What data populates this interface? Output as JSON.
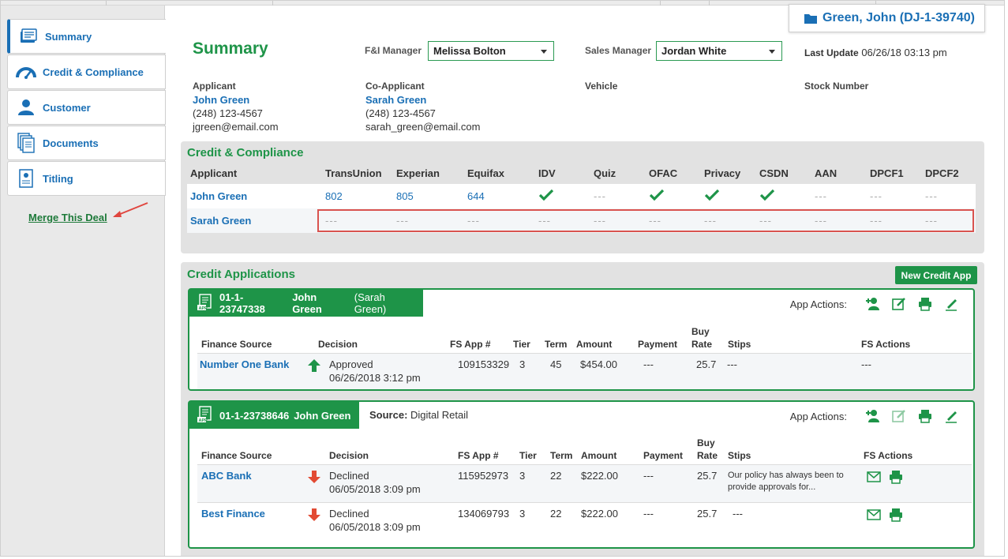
{
  "deal": {
    "label": "Green, John (DJ-1-39740)"
  },
  "sidebar": {
    "items": [
      {
        "label": "Summary"
      },
      {
        "label": "Credit & Compliance"
      },
      {
        "label": "Customer"
      },
      {
        "label": "Documents"
      },
      {
        "label": "Titling"
      }
    ],
    "merge_link": "Merge This Deal"
  },
  "header": {
    "title": "Summary",
    "fi_manager_label": "F&I Manager",
    "fi_manager_value": "Melissa Bolton",
    "sales_manager_label": "Sales Manager",
    "sales_manager_value": "Jordan White",
    "last_update_label": "Last Update",
    "last_update_value": "06/26/18 03:13 pm"
  },
  "parties": {
    "applicant": {
      "label": "Applicant",
      "name": "John Green",
      "phone": "(248) 123-4567",
      "email": "jgreen@email.com"
    },
    "co_applicant": {
      "label": "Co-Applicant",
      "name": "Sarah Green",
      "phone": "(248) 123-4567",
      "email": "sarah_green@email.com"
    },
    "vehicle_label": "Vehicle",
    "stock_label": "Stock Number"
  },
  "compliance": {
    "title": "Credit & Compliance",
    "headers": [
      "Applicant",
      "TransUnion",
      "Experian",
      "Equifax",
      "IDV",
      "Quiz",
      "OFAC",
      "Privacy",
      "CSDN",
      "AAN",
      "DPCF1",
      "DPCF2"
    ],
    "rows": [
      {
        "name": "John Green",
        "transunion": "802",
        "experian": "805",
        "equifax": "644",
        "idv": "check",
        "quiz": "---",
        "ofac": "check",
        "privacy": "check",
        "csdn": "check",
        "aan": "---",
        "dpcf1": "---",
        "dpcf2": "---"
      },
      {
        "name": "Sarah Green",
        "transunion": "---",
        "experian": "---",
        "equifax": "---",
        "idv": "---",
        "quiz": "---",
        "ofac": "---",
        "privacy": "---",
        "csdn": "---",
        "aan": "---",
        "dpcf1": "---",
        "dpcf2": "---"
      }
    ],
    "dash": "---"
  },
  "credit_apps": {
    "title": "Credit Applications",
    "new_button": "New Credit App",
    "actions_label": "App Actions:",
    "columns": {
      "finance_source": "Finance Source",
      "decision": "Decision",
      "fs_app": "FS App #",
      "tier": "Tier",
      "term": "Term",
      "amount": "Amount",
      "payment": "Payment",
      "buy_rate_1": "Buy",
      "buy_rate_2": "Rate",
      "stips": "Stips",
      "fs_actions": "FS Actions"
    },
    "apps": [
      {
        "id": "01-1-23747338",
        "applicant": "John Green",
        "co_applicant": "(Sarah Green)",
        "rows": [
          {
            "source": "Number One Bank",
            "decision": "Approved",
            "date": "06/26/2018 3:12 pm",
            "fs_app": "109153329",
            "tier": "3",
            "term": "45",
            "amount": "$454.00",
            "payment": "---",
            "buy_rate": "25.7",
            "stips": "---",
            "fs_actions": "---"
          }
        ]
      },
      {
        "id": "01-1-23738646",
        "applicant": "John Green",
        "source_label": "Source:",
        "source_value": "Digital Retail",
        "rows": [
          {
            "source": "ABC Bank",
            "decision": "Declined",
            "date": "06/05/2018 3:09 pm",
            "fs_app": "115952973",
            "tier": "3",
            "term": "22",
            "amount": "$222.00",
            "payment": "---",
            "buy_rate": "25.7",
            "stips": "Our policy has always been to provide approvals for..."
          },
          {
            "source": "Best Finance",
            "decision": "Declined",
            "date": "06/05/2018 3:09 pm",
            "fs_app": "134069793",
            "tier": "3",
            "term": "22",
            "amount": "$222.00",
            "payment": "---",
            "buy_rate": "25.7",
            "stips": "---"
          }
        ]
      }
    ]
  },
  "colors": {
    "green": "#1e9448",
    "blue": "#1a6fb5",
    "red": "#d9534f"
  }
}
